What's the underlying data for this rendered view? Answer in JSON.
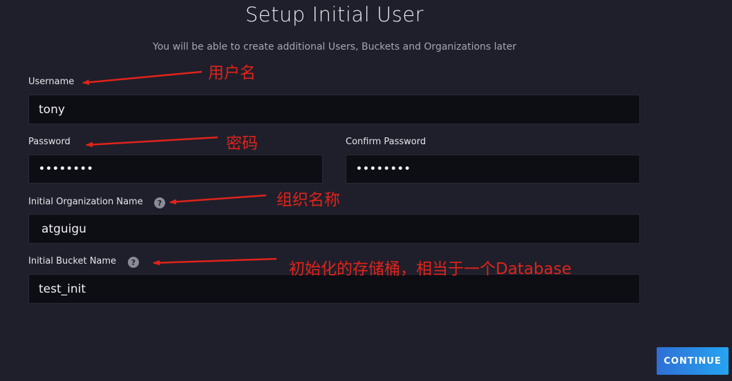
{
  "header": {
    "title": "Setup Initial User",
    "subtitle": "You will be able to create additional Users, Buckets and Organizations later"
  },
  "form": {
    "username": {
      "label": "Username",
      "value": "tony"
    },
    "password": {
      "label": "Password",
      "value": "••••••••"
    },
    "confirm_password": {
      "label": "Confirm Password",
      "value": "••••••••"
    },
    "organization": {
      "label": "Initial Organization Name",
      "value": "atguigu",
      "help": "?"
    },
    "bucket": {
      "label": "Initial Bucket Name",
      "value": "test_init",
      "help": "?"
    }
  },
  "annotations": {
    "username": "用户名",
    "password": "密码",
    "organization": "组织名称",
    "bucket": "初始化的存储桶，相当于一个Database",
    "color": "#e2231a"
  },
  "actions": {
    "continue_label": "CONTINUE"
  },
  "colors": {
    "background": "#1f1f2b",
    "input_background": "#0d0d14",
    "button_gradient_start": "#2f6fd6",
    "button_gradient_end": "#25a4f0"
  }
}
